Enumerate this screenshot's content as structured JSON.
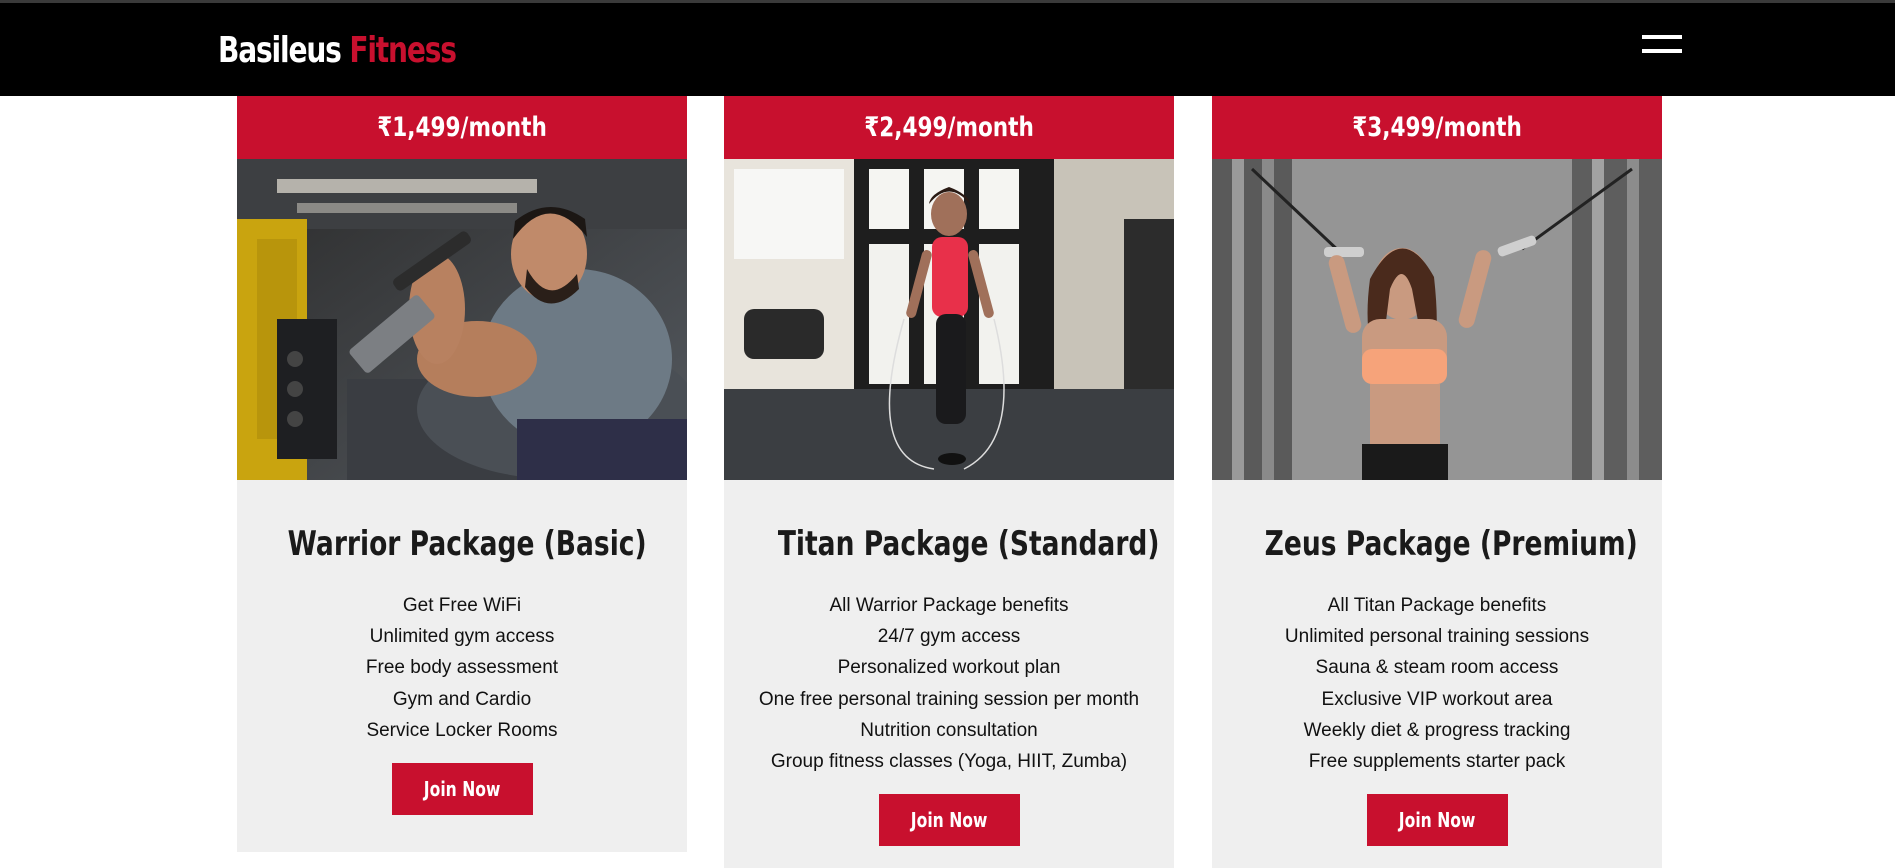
{
  "brand": {
    "part1": "Basileus",
    "part2": "Fitness"
  },
  "nav": {
    "menu_icon": "hamburger-menu-icon"
  },
  "colors": {
    "accent": "#c8102e",
    "navbar": "#000000",
    "card_bg": "#efefef"
  },
  "cards": [
    {
      "price": "₹1,499/month",
      "title": "Warrior Package (Basic)",
      "image": "man-doing-preacher-curl-photo",
      "features": [
        "Get Free WiFi",
        "Unlimited gym access",
        "Free body assessment",
        "Gym and Cardio",
        "Service Locker Rooms"
      ],
      "button": "Join Now"
    },
    {
      "price": "₹2,499/month",
      "title": "Titan Package (Standard)",
      "image": "woman-jumping-rope-photo",
      "features": [
        "All Warrior Package benefits",
        "24/7 gym access",
        "Personalized workout plan",
        "One free personal training session per month",
        "Nutrition consultation",
        "Group fitness classes (Yoga, HIIT, Zumba)"
      ],
      "button": "Join Now"
    },
    {
      "price": "₹3,499/month",
      "title": "Zeus Package (Premium)",
      "image": "woman-cable-pulldown-photo",
      "features": [
        "All Titan Package benefits",
        "Unlimited personal training sessions",
        "Sauna & steam room access",
        "Exclusive VIP workout area",
        "Weekly diet & progress tracking",
        "Free supplements starter pack"
      ],
      "button": "Join Now"
    }
  ]
}
